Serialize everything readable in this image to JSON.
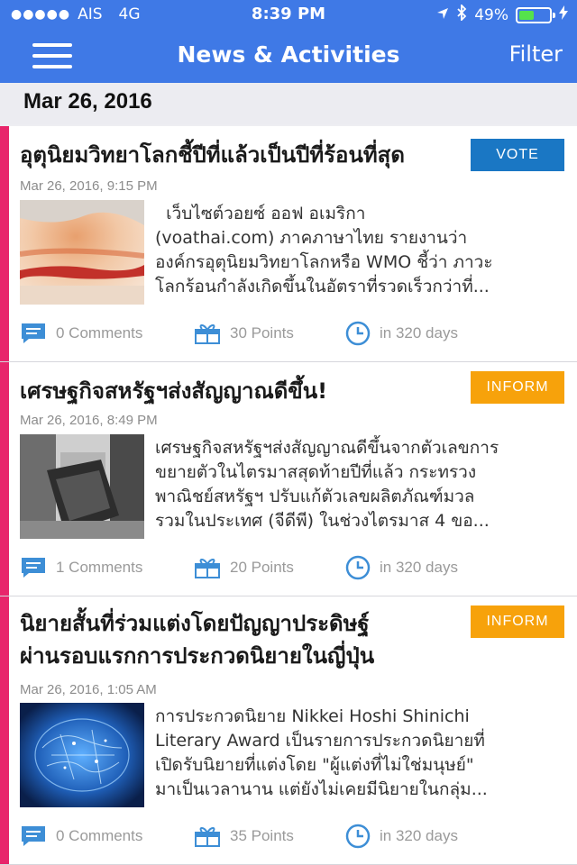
{
  "status": {
    "carrier": "AIS",
    "network": "4G",
    "time": "8:39 PM",
    "battery": "49%",
    "signal_dots": "●●●●●"
  },
  "nav": {
    "title": "News & Activities",
    "filter": "Filter"
  },
  "date_header": "Mar 26, 2016",
  "colors": {
    "accent": "#3f79e6",
    "strip": "#e8256b",
    "vote": "#1a77c4",
    "inform": "#f7a20b"
  },
  "cards": [
    {
      "title": "อุตุนิยมวิทยาโลกชี้ปีที่แล้วเป็นปีที่ร้อนที่สุด",
      "badge": "VOTE",
      "timestamp": "Mar 26, 2016, 9:15 PM",
      "excerpt_lines": [
        "  เว็บไซต์วอยซ์ ออฟ อเมริกา",
        "(voathai.com)  ภาคภาษาไทย รายงานว่า",
        "องค์กรอุตุนิยมวิทยาโลกหรือ WMO ชี้ว่า ภาวะ",
        "โลกร้อนกำลังเกิดขึ้นในอัตราที่รวดเร็วกว่าที่..."
      ],
      "comments": "0 Comments",
      "points": "30 Points",
      "days": "in 320 days"
    },
    {
      "title": "เศรษฐกิจสหรัฐฯส่งสัญญาณดีขึ้น!",
      "badge": "INFORM",
      "timestamp": "Mar 26, 2016, 8:49 PM",
      "excerpt_lines": [
        "เศรษฐกิจสหรัฐฯส่งสัญญาณดีขึ้นจากตัวเลขการ",
        "ขยายตัวในไตรมาสสุดท้ายปีที่แล้ว กระทรวง",
        "พาณิชย์สหรัฐฯ ปรับแก้ตัวเลขผลิตภัณฑ์มวล",
        "รวมในประเทศ (จีดีพี) ในช่วงไตรมาส 4 ขอ..."
      ],
      "comments": "1 Comments",
      "points": "20 Points",
      "days": "in 320 days"
    },
    {
      "title_lines": [
        "นิยายสั้นที่ร่วมแต่งโดยปัญญาประดิษฐ์",
        "ผ่านรอบแรกการประกวดนิยายในญี่ปุ่น"
      ],
      "badge": "INFORM",
      "timestamp": "Mar 26, 2016, 1:05 AM",
      "excerpt_lines": [
        "การประกวดนิยาย Nikkei Hoshi Shinichi",
        "Literary Award เป็นรายการประกวดนิยายที่",
        "เปิดรับนิยายที่แต่งโดย \"ผู้แต่งที่ไม่ใช่มนุษย์\"",
        "มาเป็นเวลานาน แต่ยังไม่เคยมีนิยายในกลุ่ม..."
      ],
      "comments": "0 Comments",
      "points": "35 Points",
      "days": "in 320 days"
    }
  ]
}
